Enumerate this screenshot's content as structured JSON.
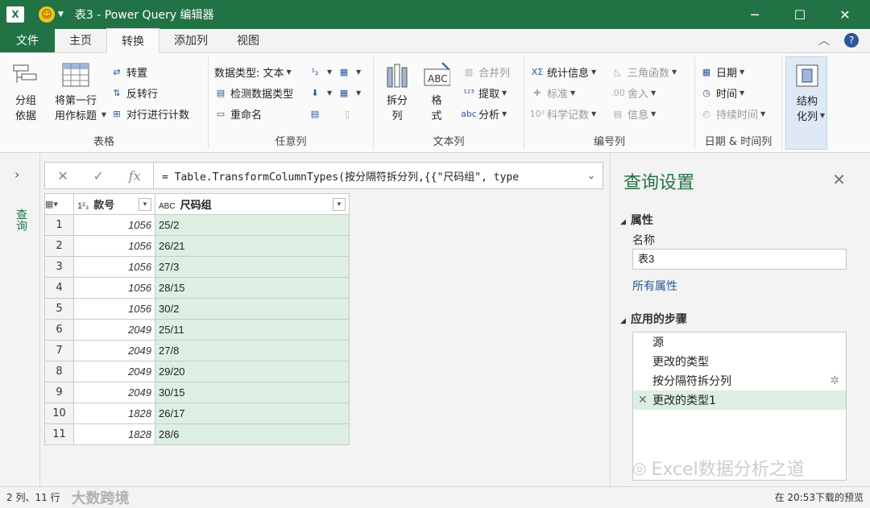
{
  "window": {
    "title": "表3 - Power Query 编辑器",
    "app_icon": "X",
    "minimize": "─",
    "maximize": "☐",
    "close": "✕"
  },
  "menu": {
    "file": "文件",
    "tabs": [
      "主页",
      "转换",
      "添加列",
      "视图"
    ],
    "active_tab": "转换"
  },
  "ribbon": {
    "table_group": {
      "label": "表格",
      "group_by": "分组\n依据",
      "use_first_row": "将第一行\n用作标题",
      "transpose": "转置",
      "reverse_rows": "反转行",
      "count_rows": "对行进行计数"
    },
    "any_column_group": {
      "label": "任意列",
      "data_type": "数据类型: 文本",
      "detect_type": "检测数据类型",
      "rename": "重命名"
    },
    "text_column_group": {
      "label": "文本列",
      "split_column": "拆分\n列",
      "format": "格\n式",
      "merge_columns": "合并列",
      "extract": "提取",
      "parse": "分析"
    },
    "number_column_group": {
      "label": "编号列",
      "statistics": "统计信息",
      "standard": "标准",
      "scientific": "科学记数",
      "trigonometry": "三角函数",
      "rounding": "舍入",
      "information": "信息"
    },
    "datetime_group": {
      "label": "日期 & 时间列",
      "date": "日期",
      "time": "时间",
      "duration": "持续时间"
    },
    "structured_group": {
      "label": "结构化列",
      "structured": "结构\n化列"
    }
  },
  "query_pane": {
    "label": "查询",
    "expand_icon": "chevron-right-icon"
  },
  "formula_bar": {
    "text": "= Table.TransformColumnTypes(按分隔符拆分列,{{\"尺码组\", type",
    "cancel": "✕",
    "confirm": "✓",
    "fx": "fx"
  },
  "table": {
    "columns": [
      {
        "type": "1²₃",
        "name": "款号"
      },
      {
        "type": "ABC",
        "name": "尺码组"
      }
    ],
    "rows": [
      {
        "n": "1",
        "a": "1056",
        "b": "25/2"
      },
      {
        "n": "2",
        "a": "1056",
        "b": "26/21"
      },
      {
        "n": "3",
        "a": "1056",
        "b": "27/3"
      },
      {
        "n": "4",
        "a": "1056",
        "b": "28/15"
      },
      {
        "n": "5",
        "a": "1056",
        "b": "30/2"
      },
      {
        "n": "6",
        "a": "2049",
        "b": "25/11"
      },
      {
        "n": "7",
        "a": "2049",
        "b": "27/8"
      },
      {
        "n": "8",
        "a": "2049",
        "b": "29/20"
      },
      {
        "n": "9",
        "a": "2049",
        "b": "30/15"
      },
      {
        "n": "10",
        "a": "1828",
        "b": "26/17"
      },
      {
        "n": "11",
        "a": "1828",
        "b": "28/6"
      }
    ]
  },
  "settings": {
    "title": "查询设置",
    "properties_label": "属性",
    "name_label": "名称",
    "name_value": "表3",
    "all_properties": "所有属性",
    "steps_label": "应用的步骤",
    "steps": [
      "源",
      "更改的类型",
      "按分隔符拆分列",
      "更改的类型1"
    ]
  },
  "status": {
    "left": "2 列、11 行",
    "right": "在 20:53下载的预览"
  },
  "watermarks": {
    "bottom_right": "Excel数据分析之道",
    "bottom_left": "大数跨境"
  },
  "colors": {
    "brand": "#217346",
    "selected": "#dcefe2",
    "link": "#2b579a"
  }
}
